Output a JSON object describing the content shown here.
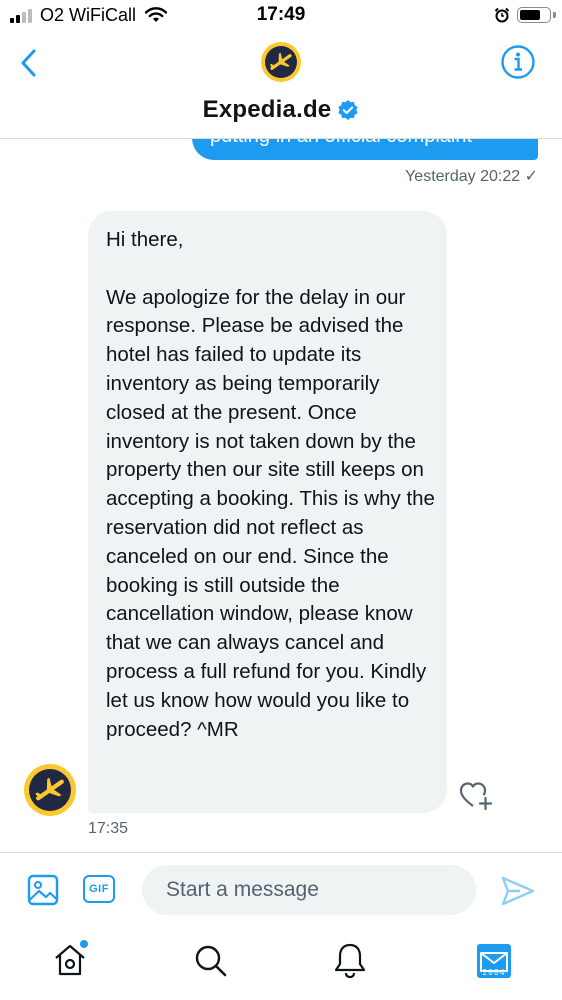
{
  "status_bar": {
    "carrier": "O2 WiFiCall",
    "time": "17:49",
    "battery_level": 0.75
  },
  "header": {
    "title": "Expedia.de",
    "verified": true
  },
  "thread": {
    "previous_message": {
      "text": "putting in an official complaint",
      "time": "Yesterday 20:22 ✓"
    },
    "message": {
      "text": "Hi there,\n\nWe apologize for the delay in our response. Please be advised the hotel has failed to update its inventory as being temporarily closed at the present. Once inventory is not taken down by the property then our site still keeps on accepting a booking. This is why the reservation did not reflect as canceled on our end. Since the booking is still outside the cancellation window, please know that we can always cancel and process a full refund for you. Kindly let us know how would you like to proceed? ^MR",
      "time": "17:35"
    }
  },
  "composer": {
    "gif_label": "GIF",
    "placeholder": "Start a message"
  },
  "bottom_nav": {
    "items": [
      "home-icon",
      "search-icon",
      "bell-icon",
      "messages-icon"
    ],
    "messages_tile_text": "2004"
  },
  "colors": {
    "accent": "#1d9bf0",
    "brand_yellow": "#fdc82f",
    "brand_navy": "#202843",
    "bubble_grey": "#eff3f4"
  }
}
